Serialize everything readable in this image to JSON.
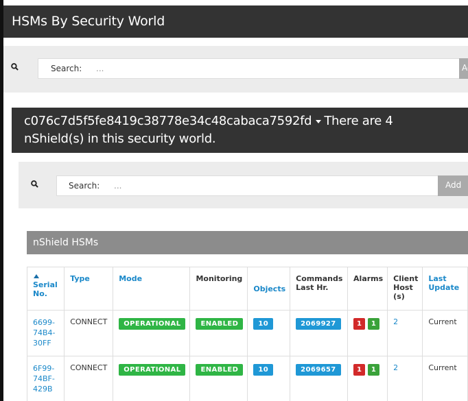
{
  "page": {
    "title": "HSMs By Security World"
  },
  "global_search": {
    "label": "Search:",
    "placeholder": "..."
  },
  "security_world": {
    "id": "c076c7d5f5fe8419c38778e34c48cabaca7592fd",
    "summary_line1_suffix": "There are 4",
    "summary_line2": "nShield(s) in this security world."
  },
  "hsm_search": {
    "label": "Search:",
    "placeholder": "...",
    "add_label": "Add"
  },
  "hsm_section": {
    "title": "nShield HSMs"
  },
  "table": {
    "columns": {
      "serial": "Serial No.",
      "type": "Type",
      "mode": "Mode",
      "monitoring": "Monitoring",
      "objects": "Objects",
      "commands": "Commands Last Hr.",
      "alarms": "Alarms",
      "client_host": "Client Host (s)",
      "last_update": "Last Update"
    },
    "rows": [
      {
        "serial": "6699-74B4-30FF",
        "type": "CONNECT",
        "mode": "OPERATIONAL",
        "monitoring": "ENABLED",
        "objects": "10",
        "commands": "2069927",
        "alarms_red": "1",
        "alarms_green": "1",
        "client_host": "2",
        "last_update": "Current"
      },
      {
        "serial": "6F99-74BF-429B",
        "type": "CONNECT",
        "mode": "OPERATIONAL",
        "monitoring": "ENABLED",
        "objects": "10",
        "commands": "2069657",
        "alarms_red": "1",
        "alarms_green": "1",
        "client_host": "2",
        "last_update": "Current"
      }
    ]
  },
  "colors": {
    "title_bar": "#333333",
    "panel_bg": "#ececec",
    "section_header": "#8c8c8c",
    "link": "#1a88c9",
    "badge_green": "#2fb545",
    "badge_blue": "#1f98d6",
    "badge_red": "#d22a2a"
  },
  "icons": {
    "search": "search-icon",
    "dropdown": "caret-down-icon",
    "sort": "sort-ascending-icon"
  }
}
